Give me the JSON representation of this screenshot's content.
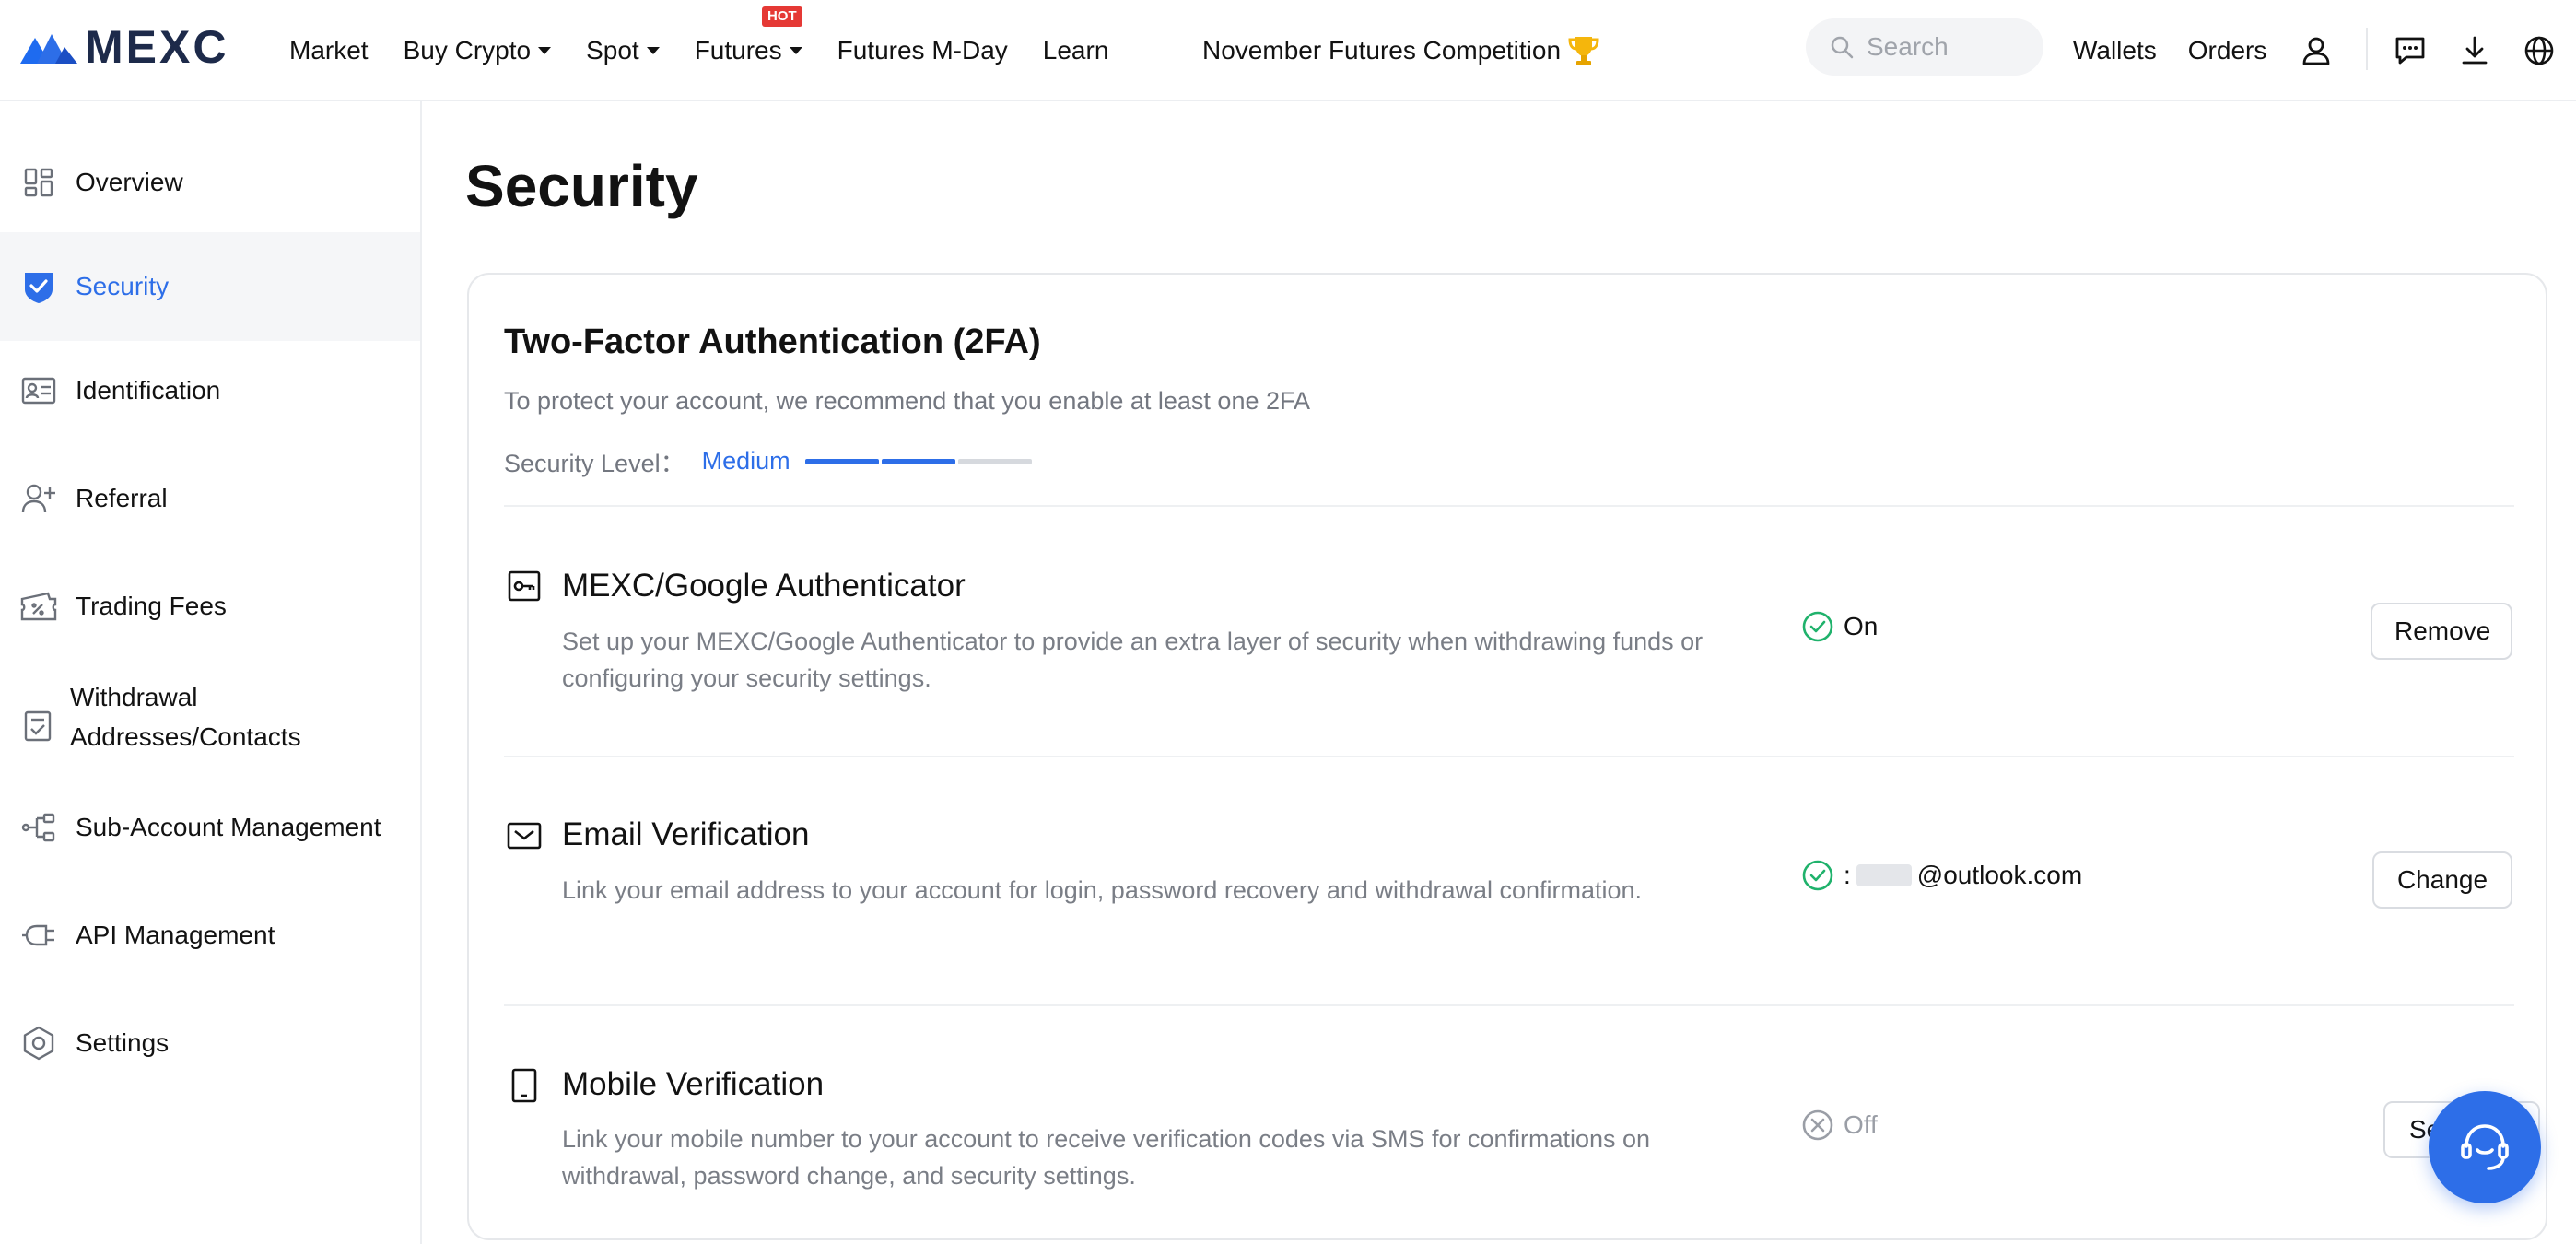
{
  "brand": {
    "name": "MEXC",
    "accent": "#2d6ee8"
  },
  "nav": {
    "market": "Market",
    "buy_crypto": "Buy Crypto",
    "spot": "Spot",
    "futures": "Futures",
    "hot_badge": "HOT",
    "futures_mday": "Futures M-Day",
    "learn": "Learn",
    "competition": "November Futures Competition"
  },
  "search": {
    "placeholder": "Search"
  },
  "header_right": {
    "wallets": "Wallets",
    "orders": "Orders",
    "icons": [
      "user-icon",
      "chat-icon",
      "download-icon",
      "globe-icon"
    ]
  },
  "sidebar": {
    "items": [
      {
        "label": "Overview",
        "icon": "overview-icon",
        "active": false
      },
      {
        "label": "Security",
        "icon": "shield-icon",
        "active": true
      },
      {
        "label": "Identification",
        "icon": "id-card-icon",
        "active": false
      },
      {
        "label": "Referral",
        "icon": "add-user-icon",
        "active": false
      },
      {
        "label": "Trading Fees",
        "icon": "ticket-icon",
        "active": false
      },
      {
        "label": "Withdrawal Addresses/Contacts",
        "label_line1": "Withdrawal",
        "label_line2": "Addresses/Contacts",
        "icon": "address-book-icon",
        "active": false
      },
      {
        "label": "Sub-Account Management",
        "icon": "sub-account-icon",
        "active": false
      },
      {
        "label": "API Management",
        "icon": "plug-icon",
        "active": false
      },
      {
        "label": "Settings",
        "icon": "settings-icon",
        "active": false
      }
    ]
  },
  "page": {
    "title": "Security"
  },
  "twofa": {
    "title": "Two-Factor Authentication (2FA)",
    "subtitle": "To protect your account, we recommend that you enable at least one 2FA",
    "level_label": "Security Level：",
    "level_value": "Medium",
    "level_filled_segments": 2,
    "level_total_segments": 3,
    "colors": {
      "filled": "#2d6ee8",
      "empty": "#d6d9de"
    }
  },
  "methods": [
    {
      "icon": "authenticator-key-icon",
      "title": "MEXC/Google Authenticator",
      "description": "Set up your MEXC/Google Authenticator to provide an extra layer of security when withdrawing funds or configuring your security settings.",
      "status_icon": "check-circle-icon",
      "status_text": "On",
      "button": "Remove"
    },
    {
      "icon": "mail-icon",
      "title": "Email Verification",
      "description": "Link your email address to your account for login, password recovery and withdrawal confirmation.",
      "status_icon": "check-circle-icon",
      "status_prefix": ":",
      "status_text": "@outlook.com",
      "button": "Change"
    },
    {
      "icon": "mobile-icon",
      "title": "Mobile Verification",
      "description": "Link your mobile number to your account to receive verification codes via SMS for confirmations on withdrawal, password change, and security settings.",
      "status_icon": "x-circle-icon",
      "status_text": "Off",
      "button": "Se"
    }
  ],
  "status_colors": {
    "on": "#20b26c",
    "off": "#9a9ea6"
  }
}
